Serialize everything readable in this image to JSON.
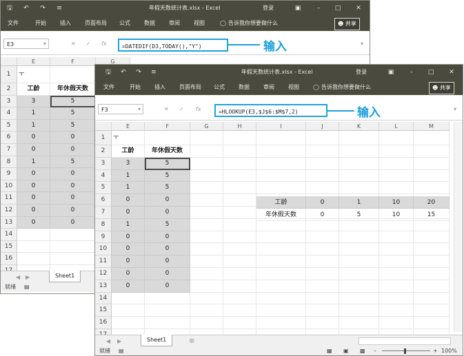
{
  "back": {
    "title": "年假天数统计表.xlsx - Excel",
    "login": "登录",
    "ribbon_tabs": [
      "文件",
      "开始",
      "插入",
      "页面布局",
      "公式",
      "数据",
      "审阅",
      "视图"
    ],
    "tell_me": "告诉我你想要做什么",
    "share": "共享",
    "name_box": "E3",
    "formula": "=DATEDIF(D3,TODAY(),\"Y\")",
    "annotation": "输入",
    "columns": [
      "E",
      "F",
      "G"
    ],
    "rows": [
      "1",
      "2",
      "3",
      "4",
      "5",
      "6",
      "7",
      "8",
      "9",
      "10",
      "11",
      "12",
      "13",
      "14",
      "15",
      "16",
      "17",
      "18"
    ],
    "row1_mark": "ㅜ",
    "header": [
      "工龄",
      "年休假天数"
    ],
    "data": [
      [
        "3",
        "5"
      ],
      [
        "1",
        "5"
      ],
      [
        "1",
        "5"
      ],
      [
        "0",
        "0"
      ],
      [
        "0",
        "0"
      ],
      [
        "1",
        "5"
      ],
      [
        "0",
        "0"
      ],
      [
        "0",
        "0"
      ],
      [
        "0",
        "0"
      ],
      [
        "0",
        "0"
      ],
      [
        "0",
        "0"
      ]
    ],
    "sheet_tab": "Sheet1",
    "status": "就绪"
  },
  "front": {
    "title": "年假天数统计表.xlsx - Excel",
    "login": "登录",
    "ribbon_tabs": [
      "文件",
      "开始",
      "插入",
      "页面布局",
      "公式",
      "数据",
      "审阅",
      "视图"
    ],
    "tell_me": "告诉我你想要做什么",
    "share": "共享",
    "name_box": "F3",
    "formula": "=HLOOKUP(E3,$J$6:$M$7,2)",
    "annotation": "输入",
    "columns": [
      "E",
      "F",
      "G",
      "H",
      "I",
      "J",
      "K",
      "L",
      "M"
    ],
    "rows": [
      "1",
      "2",
      "3",
      "4",
      "5",
      "6",
      "7",
      "8",
      "9",
      "10",
      "11",
      "12",
      "13",
      "14",
      "15",
      "16",
      "17",
      "18"
    ],
    "row1_mark": "ㅜ",
    "header": [
      "工龄",
      "年休假天数"
    ],
    "data": [
      [
        "3",
        "5"
      ],
      [
        "1",
        "5"
      ],
      [
        "1",
        "5"
      ],
      [
        "0",
        "0"
      ],
      [
        "0",
        "0"
      ],
      [
        "1",
        "5"
      ],
      [
        "0",
        "0"
      ],
      [
        "0",
        "0"
      ],
      [
        "0",
        "0"
      ],
      [
        "0",
        "0"
      ],
      [
        "0",
        "0"
      ]
    ],
    "lookup": {
      "row6_label": "工龄",
      "row6_values": [
        "0",
        "1",
        "10",
        "20"
      ],
      "row7_label": "年休假天数",
      "row7_values": [
        "0",
        "5",
        "10",
        "15"
      ]
    },
    "sheet_tab": "Sheet1",
    "status": "就绪",
    "zoom": "100%"
  }
}
